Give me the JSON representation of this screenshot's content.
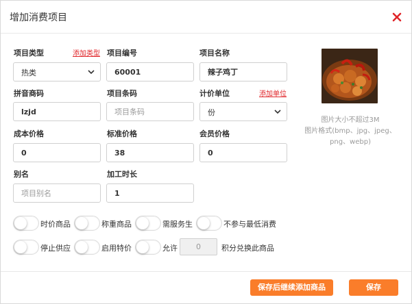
{
  "dialog": {
    "title": "增加消费项目"
  },
  "form": {
    "item_type": {
      "label": "项目类型",
      "add_link": "添加类型",
      "value": "热类"
    },
    "item_code": {
      "label": "项目编号",
      "value": "60001"
    },
    "item_name": {
      "label": "项目名称",
      "value": "辣子鸡丁"
    },
    "pinyin_code": {
      "label": "拼音商码",
      "value": "lzjd"
    },
    "barcode": {
      "label": "项目条码",
      "placeholder": "项目条码"
    },
    "unit": {
      "label": "计价单位",
      "add_link": "添加单位",
      "value": "份"
    },
    "cost_price": {
      "label": "成本价格",
      "value": "0"
    },
    "standard_price": {
      "label": "标准价格",
      "value": "38"
    },
    "member_price": {
      "label": "会员价格",
      "value": "0"
    },
    "alias": {
      "label": "别名",
      "placeholder": "项目别名"
    },
    "processing_time": {
      "label": "加工时长",
      "value": "1"
    }
  },
  "image": {
    "hint_line1": "图片大小不超过3M",
    "hint_line2": "图片格式(bmp、jpg、jpeg、",
    "hint_line3": "png、webp)"
  },
  "toggles": {
    "seasonal_price": "时价商品",
    "weighed_item": "称重商品",
    "needs_waiter": "需服务生",
    "exclude_min_spend": "不参与最低消费",
    "stop_supply": "停止供应",
    "enable_special_price": "启用特价",
    "allow_points": "允许",
    "points_value": "0",
    "points_suffix": "积分兑换此商品"
  },
  "footer": {
    "save_continue_label": "保存后继续添加商品",
    "save_label": "保存"
  },
  "colors": {
    "accent": "#fa7d2a",
    "link_red": "#e0262a",
    "close_red": "#e0262a"
  }
}
